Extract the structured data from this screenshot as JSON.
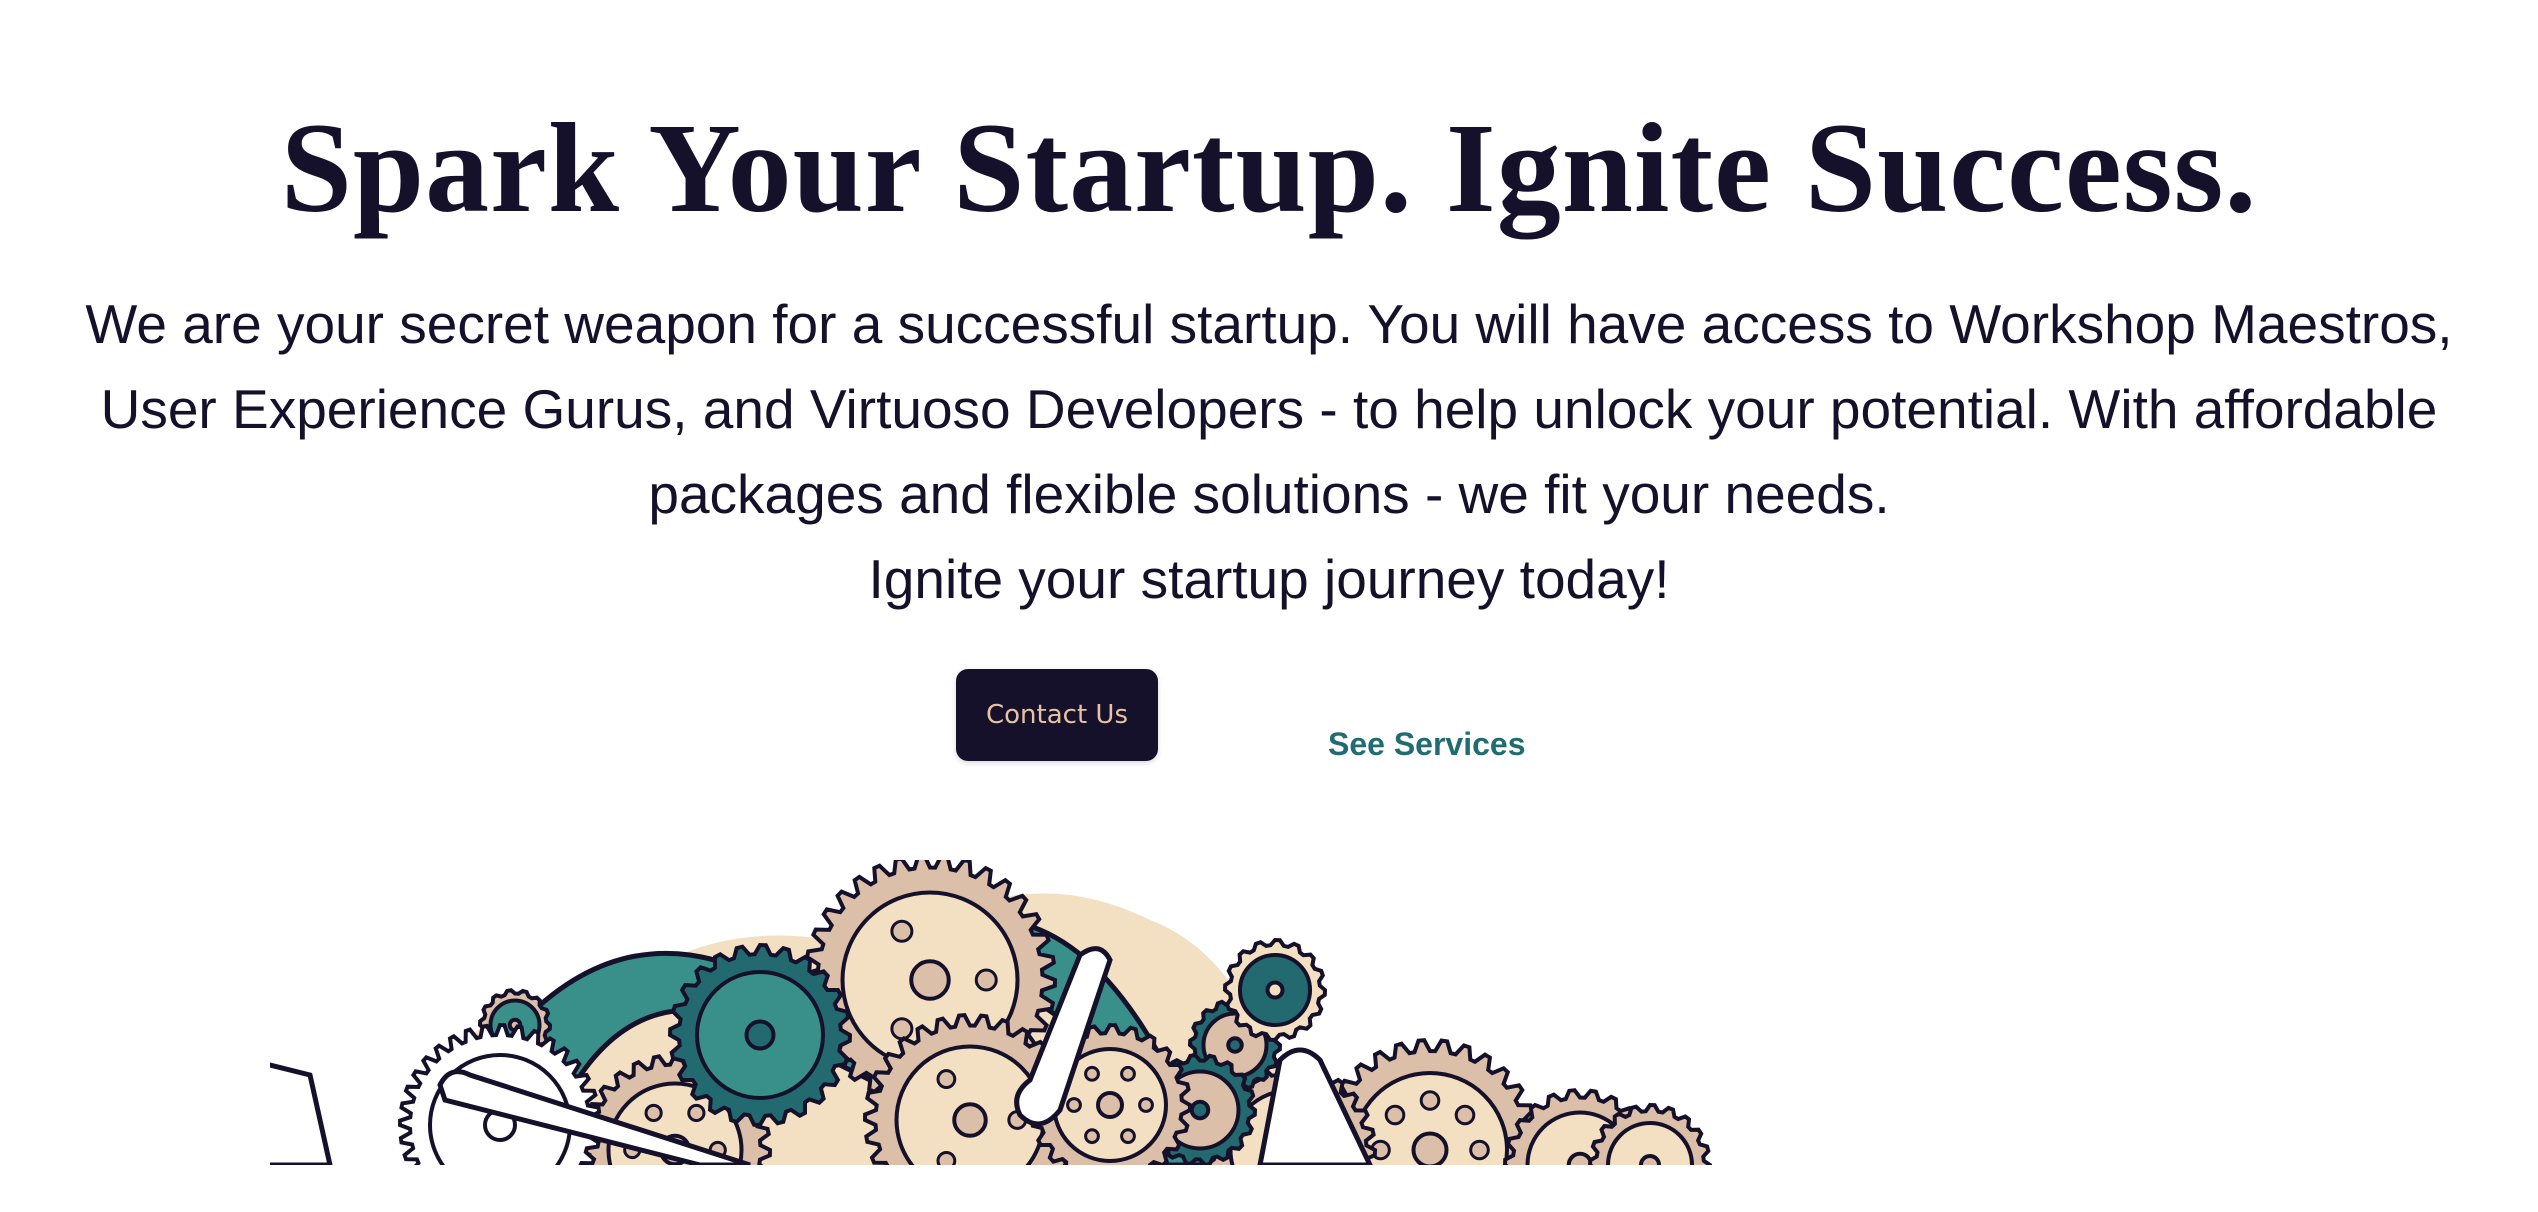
{
  "hero": {
    "title": "Spark Your Startup. Ignite Success.",
    "lead_lines": [
      "We are your secret weapon for a successful startup. You will have access to Workshop Maestros,",
      "User Experience Gurus, and Virtuoso Developers - to help unlock your potential. With affordable",
      "packages and flexible solutions - we fit your needs.",
      "Ignite your startup journey today!"
    ],
    "contact_label": "Contact Us",
    "services_label": "See Services"
  },
  "colors": {
    "ink": "#16112b",
    "teal": "#39908b",
    "dark_teal": "#236a70",
    "tan": "#dcbfa8",
    "cream": "#f3dfc1",
    "button_text": "#e8c2a2",
    "link": "#216c72"
  },
  "illustration": {
    "icon": "gears-illustration"
  }
}
